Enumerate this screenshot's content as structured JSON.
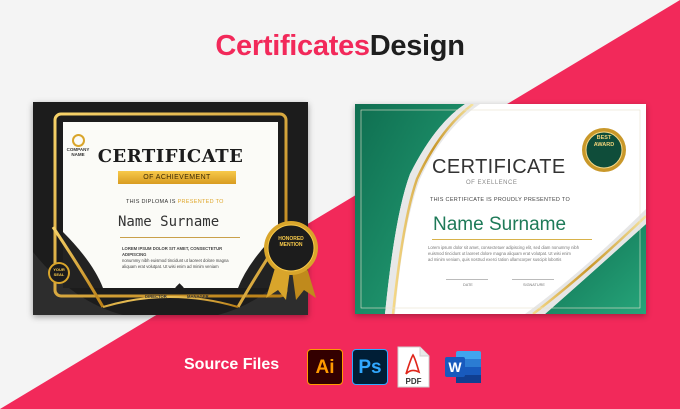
{
  "header": {
    "title_part1": "Certificates",
    "title_part2": "Design"
  },
  "certificate_dark": {
    "company": "COMPANY NAME",
    "heading": "CERTIFICATE",
    "ribbon": "OF ACHIEVEMENT",
    "diploma_prefix": "THIS DIPLOMA IS",
    "diploma_highlight": "PRESENTED TO",
    "name": "Name Surname",
    "lorem_line1": "LOREM IPSUM DOLOR SIT AMET, CONSECTETUR ADIPISCING",
    "lorem_line2": "nonummy nibh euismod tincidunt ut laoreet dolore magna",
    "lorem_line3": "aliquam erat volutpat. Ut wisi enim ad minim veniam",
    "sign_left": "DIRECTOR",
    "sign_right": "MANAGER",
    "seal_text": "HONORED MENTION",
    "small_seal_text": "YOUR SEAL",
    "colors": {
      "gold": "#d9a52b",
      "dark": "#1d1d1d"
    }
  },
  "certificate_green": {
    "heading": "CERTIFICATE",
    "sub": "OF EXELLENCE",
    "proud": "THIS CERTIFICATE IS PROUDLY PRESENTED TO",
    "name": "Name Surname",
    "lorem_line1": "Lorem ipsum dolor sit amet, consectetuer adipiscing elit, sed diam nonummy nibh",
    "lorem_line2": "euismod tincidunt ut laoreet dolore magna aliquam erat volutpat. Ut wisi enim",
    "lorem_line3": "ad minim veniam, quis nostrud exerci tation ullamcorper suscipit lobortis",
    "sig_left": "DATE",
    "sig_right": "SIGNATURE",
    "seal_text": "BEST AWARD",
    "colors": {
      "green": "#1e8a65",
      "gold": "#d8b24a"
    }
  },
  "footer": {
    "label": "Source Files",
    "icons": [
      {
        "name": "illustrator-icon",
        "text": "Ai"
      },
      {
        "name": "photoshop-icon",
        "text": "Ps"
      },
      {
        "name": "pdf-icon",
        "text": "PDF"
      },
      {
        "name": "word-icon",
        "text": "W"
      }
    ]
  },
  "colors": {
    "accent": "#f2295a",
    "background": "#f4f4f4"
  }
}
